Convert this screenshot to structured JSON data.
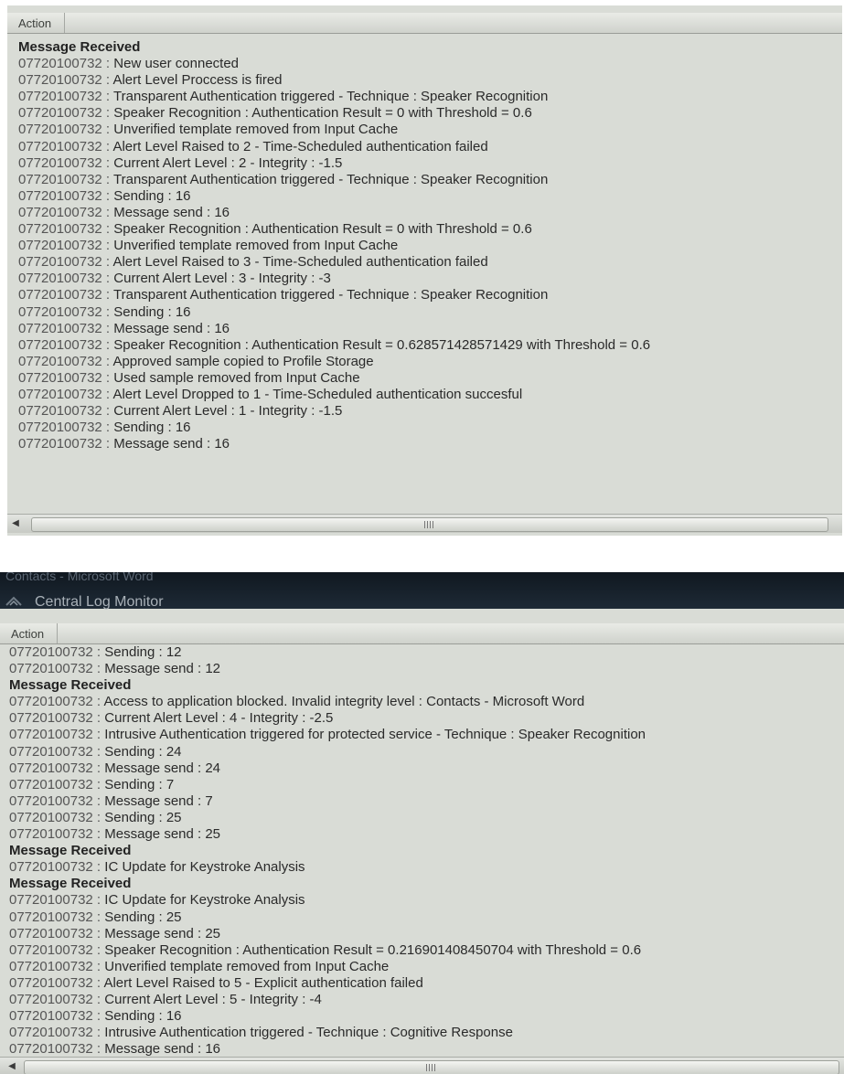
{
  "window_top": {
    "column_header": "Action",
    "entries": [
      {
        "text": "Message Received",
        "bold": true
      },
      {
        "id": "07720100732",
        "msg": "New user connected"
      },
      {
        "id": "07720100732",
        "msg": "Alert Level Proccess is fired"
      },
      {
        "id": "07720100732",
        "msg": "Transparent Authentication triggered - Technique : Speaker Recognition"
      },
      {
        "id": "07720100732",
        "msg": "Speaker Recognition : Authentication Result = 0 with Threshold = 0.6"
      },
      {
        "id": "07720100732",
        "msg": "Unverified template removed from Input Cache"
      },
      {
        "id": "07720100732",
        "msg": "Alert Level Raised to 2 - Time-Scheduled authentication failed"
      },
      {
        "id": "07720100732",
        "msg": "Current Alert Level : 2 - Integrity : -1.5"
      },
      {
        "id": "07720100732",
        "msg": "Transparent Authentication triggered - Technique : Speaker Recognition"
      },
      {
        "id": "07720100732",
        "msg": "Sending : 16"
      },
      {
        "id": "07720100732",
        "msg": "Message send : 16"
      },
      {
        "id": "07720100732",
        "msg": "Speaker Recognition : Authentication Result = 0 with Threshold = 0.6"
      },
      {
        "id": "07720100732",
        "msg": "Unverified template removed from Input Cache"
      },
      {
        "id": "07720100732",
        "msg": "Alert Level Raised to 3 - Time-Scheduled authentication failed"
      },
      {
        "id": "07720100732",
        "msg": "Current Alert Level : 3 - Integrity : -3"
      },
      {
        "id": "07720100732",
        "msg": "Transparent Authentication triggered - Technique : Speaker Recognition"
      },
      {
        "id": "07720100732",
        "msg": "Sending : 16"
      },
      {
        "id": "07720100732",
        "msg": "Message send : 16"
      },
      {
        "id": "07720100732",
        "msg": "Speaker Recognition : Authentication Result = 0.628571428571429 with Threshold = 0.6"
      },
      {
        "id": "07720100732",
        "msg": "Approved sample copied to Profile Storage"
      },
      {
        "id": "07720100732",
        "msg": "Used sample removed from Input Cache"
      },
      {
        "id": "07720100732",
        "msg": "Alert Level Dropped to 1 - Time-Scheduled authentication succesful"
      },
      {
        "id": "07720100732",
        "msg": "Current Alert Level : 1 - Integrity : -1.5"
      },
      {
        "id": "07720100732",
        "msg": "Sending : 16"
      },
      {
        "id": "07720100732",
        "msg": "Message send : 16"
      }
    ]
  },
  "window_bottom": {
    "window_title": "Central Log Monitor",
    "background_window_title": "Contacts - Microsoft Word",
    "column_header": "Action",
    "entries": [
      {
        "id": "07720100732",
        "msg": "Sending : 12"
      },
      {
        "id": "07720100732",
        "msg": "Message send : 12"
      },
      {
        "text": "Message Received",
        "bold": true
      },
      {
        "id": "07720100732",
        "msg": "Access to application blocked. Invalid integrity level : Contacts - Microsoft Word"
      },
      {
        "id": "07720100732",
        "msg": "Current Alert Level : 4 - Integrity : -2.5"
      },
      {
        "id": "07720100732",
        "msg": "Intrusive Authentication triggered for protected service - Technique : Speaker Recognition"
      },
      {
        "id": "07720100732",
        "msg": "Sending : 24"
      },
      {
        "id": "07720100732",
        "msg": "Message send : 24"
      },
      {
        "id": "07720100732",
        "msg": "Sending : 7"
      },
      {
        "id": "07720100732",
        "msg": "Message send : 7"
      },
      {
        "id": "07720100732",
        "msg": "Sending : 25"
      },
      {
        "id": "07720100732",
        "msg": "Message send : 25"
      },
      {
        "text": "Message Received",
        "bold": true
      },
      {
        "id": "07720100732",
        "msg": "IC Update for Keystroke Analysis"
      },
      {
        "text": "Message Received",
        "bold": true
      },
      {
        "id": "07720100732",
        "msg": "IC Update for Keystroke Analysis"
      },
      {
        "id": "07720100732",
        "msg": "Sending : 25"
      },
      {
        "id": "07720100732",
        "msg": "Message send : 25"
      },
      {
        "id": "07720100732",
        "msg": "Speaker Recognition : Authentication Result = 0.216901408450704 with Threshold = 0.6"
      },
      {
        "id": "07720100732",
        "msg": "Unverified template removed from Input Cache"
      },
      {
        "id": "07720100732",
        "msg": "Alert Level Raised to 5 - Explicit authentication failed"
      },
      {
        "id": "07720100732",
        "msg": "Current Alert Level : 5 - Integrity : -4"
      },
      {
        "id": "07720100732",
        "msg": "Sending : 16"
      },
      {
        "id": "07720100732",
        "msg": "Intrusive Authentication triggered - Technique : Cognitive Response"
      },
      {
        "id": "07720100732",
        "msg": "Message send : 16"
      }
    ]
  },
  "icons": {
    "scroll_left": "scroll-left-arrow-icon",
    "scroll_right": "scroll-right-arrow-icon",
    "app": "central-log-monitor-app-icon",
    "grip": "scrollbar-grip-icon"
  }
}
